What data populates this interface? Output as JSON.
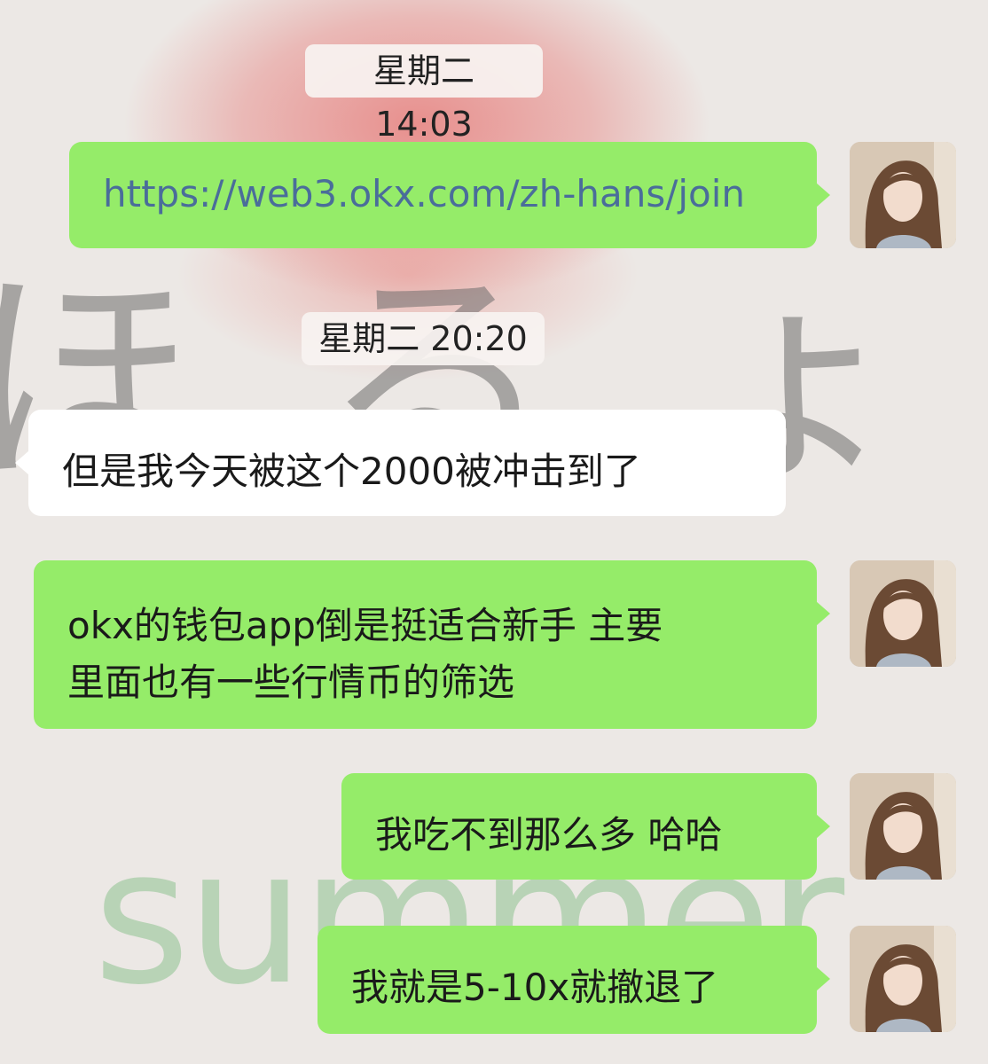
{
  "chat": {
    "timestamps": [
      "星期二 14:03",
      "星期二 20:20"
    ],
    "messages": [
      {
        "sender": "self",
        "text": "https://web3.okx.com/zh-hans/join"
      },
      {
        "sender": "other",
        "text": "但是我今天被这个2000被冲击到了"
      },
      {
        "sender": "self",
        "lines": [
          "okx的钱包app倒是挺适合新手  主要",
          "里面也有一些行情币的筛选"
        ]
      },
      {
        "sender": "self",
        "text": "我吃不到那么多 哈哈"
      },
      {
        "sender": "self",
        "text": "我就是5-10x就撤退了"
      }
    ]
  },
  "wallpaper": {
    "script": "ほ る ょ い",
    "word": "summer"
  },
  "colors": {
    "self_bubble": "#95ec69",
    "other_bubble": "#ffffff",
    "link": "#4a6d9a",
    "background": "#ece8e5"
  }
}
